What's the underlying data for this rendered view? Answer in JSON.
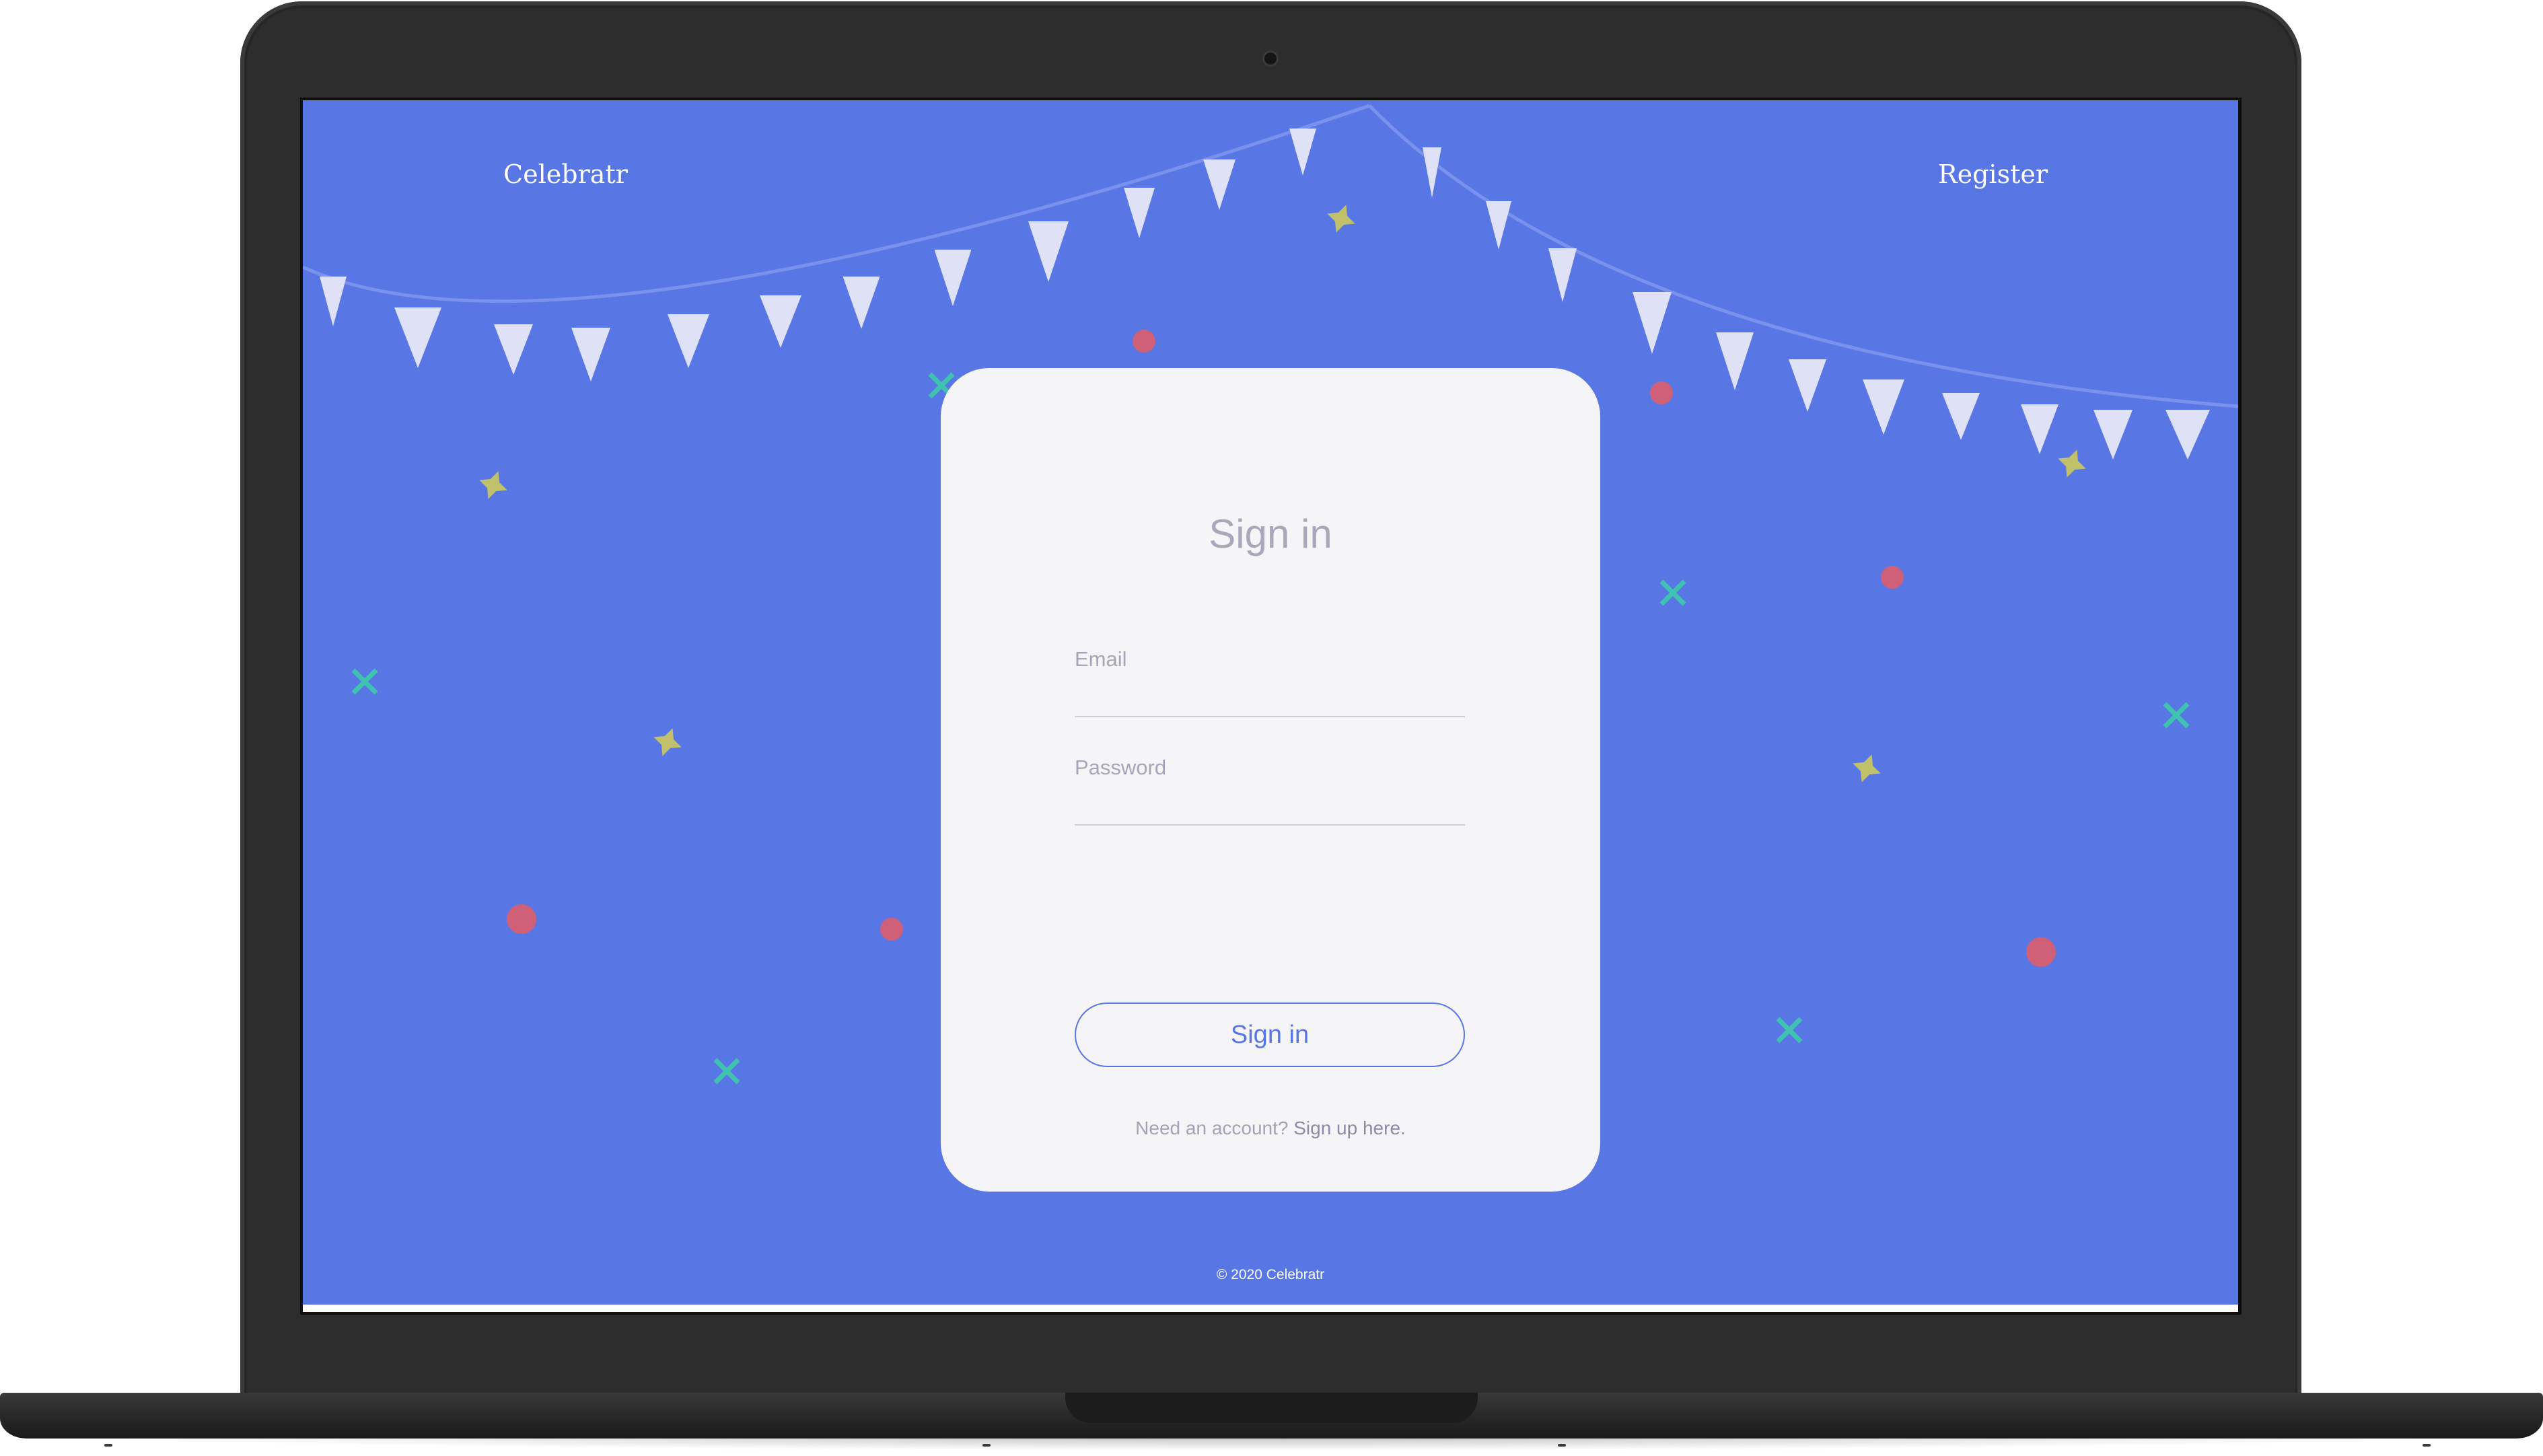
{
  "nav": {
    "brand": "Celebratr",
    "register": "Register"
  },
  "signin_card": {
    "title": "Sign in",
    "email_label": "Email",
    "email_value": "",
    "password_label": "Password",
    "password_value": "",
    "button_label": "Sign in",
    "signup_prompt": "Need an account?",
    "signup_link": "Sign up here."
  },
  "footer": {
    "copyright": "© 2020 Celebratr"
  },
  "colors": {
    "background": "#5877e5",
    "card": "#f5f5f8",
    "accent": "#5877e5",
    "pennant": "#dfe2f6",
    "confetti_dot": "#cf6078",
    "confetti_x": "#3fc3b0",
    "confetti_star": "#c1c16c"
  },
  "decorations": {
    "pennant_icon": "pennant-flag-icon",
    "dot_icon": "confetti-dot-icon",
    "x_icon": "confetti-x-icon",
    "star_icon": "confetti-star-icon"
  }
}
